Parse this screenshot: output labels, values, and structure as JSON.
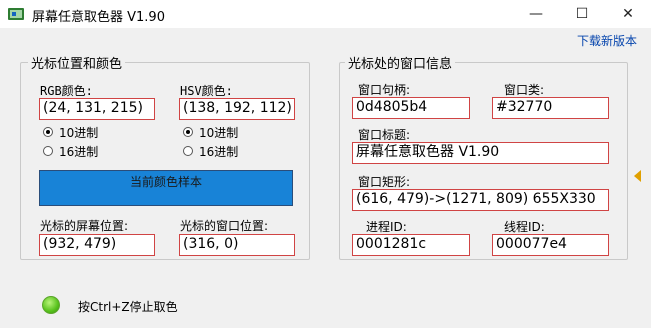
{
  "window": {
    "title": "屏幕任意取色器 V1.90",
    "minimize": "—",
    "maximize": "☐",
    "close": "✕",
    "download_link": "下载新版本"
  },
  "left_group": {
    "legend": "光标位置和颜色",
    "rgb_label": "RGB颜色:",
    "rgb_value": "(24, 131, 215)",
    "hsv_label": "HSV颜色:",
    "hsv_value": "(138, 192, 112)",
    "radio_decimal": "10进制",
    "radio_hex": "16进制",
    "sample_label": "当前颜色样本",
    "sample_color": "#1883d7",
    "screen_pos_label": "光标的屏幕位置:",
    "screen_pos_value": "(932, 479)",
    "window_pos_label": "光标的窗口位置:",
    "window_pos_value": "(316, 0)"
  },
  "right_group": {
    "legend": "光标处的窗口信息",
    "handle_label": "窗口句柄:",
    "handle_value": "0d4805b4",
    "class_label": "窗口类:",
    "class_value": "#32770",
    "title_label": "窗口标题:",
    "title_value": "屏幕任意取色器 V1.90",
    "rect_label": "窗口矩形:",
    "rect_value": "(616, 479)->(1271, 809) 655X330",
    "pid_label": "进程ID:",
    "pid_value": "0001281c",
    "tid_label": "线程ID:",
    "tid_value": "000077e4"
  },
  "status": {
    "hint": "按Ctrl+Z停止取色",
    "indicator_color": "#58c21c"
  }
}
